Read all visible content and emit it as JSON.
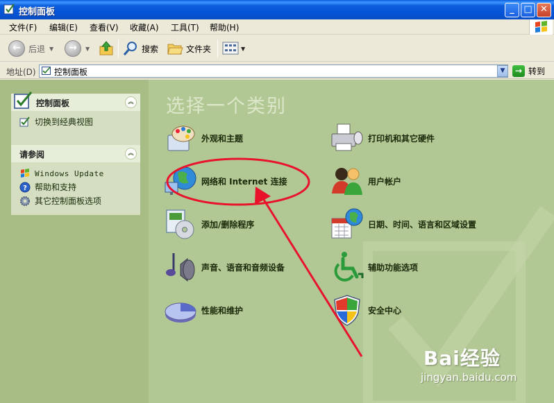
{
  "window": {
    "title": "控制面板"
  },
  "menu": [
    "文件(F)",
    "编辑(E)",
    "查看(V)",
    "收藏(A)",
    "工具(T)",
    "帮助(H)"
  ],
  "toolbar": {
    "back": "后退",
    "search": "搜索",
    "folders": "文件夹"
  },
  "address": {
    "label": "地址(D)",
    "value": "控制面板",
    "go": "转到"
  },
  "sidebar": {
    "panel_box": {
      "title": "控制面板",
      "link": "切换到经典视图"
    },
    "see_also": {
      "title": "请参阅",
      "links": [
        "Windows Update",
        "帮助和支持",
        "其它控制面板选项"
      ]
    }
  },
  "main": {
    "heading": "选择一个类别",
    "categories": [
      "外观和主题",
      "打印机和其它硬件",
      "网络和 Internet 连接",
      "用户帐户",
      "添加/删除程序",
      "日期、时间、语言和区域设置",
      "声音、语音和音频设备",
      "辅助功能选项",
      "性能和维护",
      "安全中心"
    ]
  },
  "watermark": {
    "brand": "Bai经验",
    "url": "jingyan.baidu.com"
  },
  "colors": {
    "annotation": "#E8132B",
    "xp_blue": "#0A5FDB",
    "category_bg": "#B2C894",
    "sidebar_bg": "#A8BC85"
  }
}
